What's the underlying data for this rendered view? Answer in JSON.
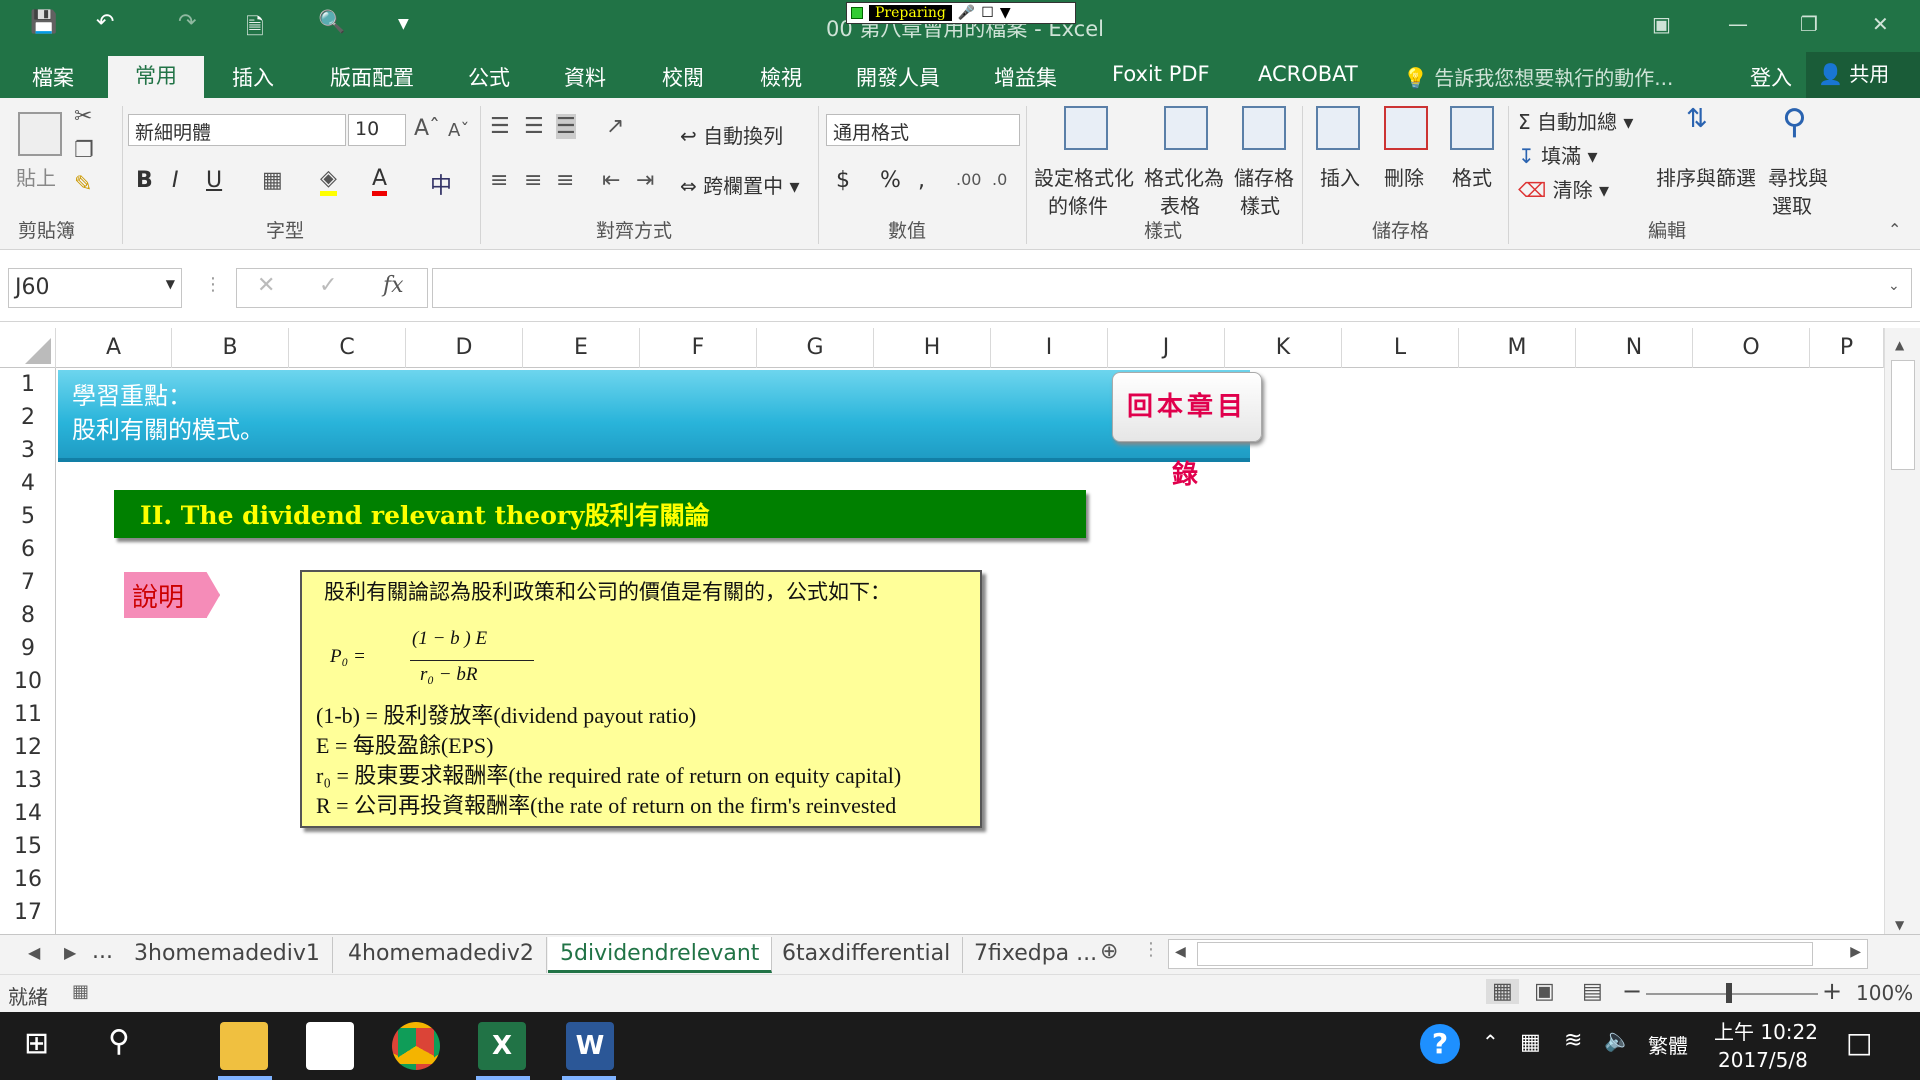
{
  "titlebar": {
    "title": "00 第八章曾用的檔案 - Excel",
    "recorder_status": "Preparing"
  },
  "tabs": [
    "檔案",
    "常用",
    "插入",
    "版面配置",
    "公式",
    "資料",
    "校閱",
    "檢視",
    "開發人員",
    "增益集",
    "Foxit PDF",
    "ACROBAT"
  ],
  "tell_me": "告訴我您想要執行的動作...",
  "sign_in": "登入",
  "share": "共用",
  "ribbon": {
    "paste": "貼上",
    "font_name": "新細明體",
    "font_size": "10",
    "wrap_text": "自動換列",
    "merge_center": "跨欄置中",
    "number_format": "通用格式",
    "cond_format_1": "設定格式化",
    "cond_format_2": "的條件",
    "table_format_1": "格式化為",
    "table_format_2": "表格",
    "cell_styles_1": "儲存格",
    "cell_styles_2": "樣式",
    "insert": "插入",
    "delete": "刪除",
    "format": "格式",
    "autosum": "自動加總",
    "fill": "填滿",
    "clear": "清除",
    "sort_filter": "排序與篩選",
    "find_1": "尋找與",
    "find_2": "選取",
    "groups": {
      "clipboard": "剪貼簿",
      "font": "字型",
      "alignment": "對齊方式",
      "number": "數值",
      "styles": "樣式",
      "cells": "儲存格",
      "editing": "編輯"
    }
  },
  "formula_bar": {
    "name_box": "J60",
    "fx": "fx",
    "content": ""
  },
  "columns": [
    "A",
    "B",
    "C",
    "D",
    "E",
    "F",
    "G",
    "H",
    "I",
    "J",
    "K",
    "L",
    "M",
    "N",
    "O",
    "P"
  ],
  "rows": [
    "1",
    "2",
    "3",
    "4",
    "5",
    "6",
    "7",
    "8",
    "9",
    "10",
    "11",
    "12",
    "13",
    "14",
    "15",
    "16",
    "17"
  ],
  "sheet": {
    "banner_line1": "學習重點：",
    "banner_line2": "股利有關的模式。",
    "back_button": "回本章目錄",
    "heading": "II. The dividend relevant theory股利有關論",
    "note_label": "說明",
    "box": {
      "intro": "股利有關論認為股利政策和公司的價值是有關的，公式如下：",
      "formula_lhs": "P₀  =",
      "formula_num": "(1 − b ) E",
      "formula_den": "r₀ − bR",
      "line1": "(1-b) = 股利發放率(dividend payout ratio)",
      "line2": "E = 每股盈餘(EPS)",
      "line3": "r₀ = 股東要求報酬率(the required rate of return on equity capital)",
      "line4": "R = 公司再投資報酬率(the rate of return on the firm's reinvested"
    }
  },
  "sheet_tabs": [
    "...",
    "3homemadediv1",
    "4homemadediv2",
    "5dividendrelevant",
    "6taxdifferential",
    "7fixedpa ..."
  ],
  "status": {
    "ready": "就緒",
    "zoom": "100%"
  },
  "taskbar": {
    "ime": "繁體",
    "time": "上午 10:22",
    "date": "2017/5/8"
  },
  "colors": {
    "excel_green": "#217346",
    "banner_blue": "#29b4da",
    "heading_green": "#008000",
    "heading_text": "#ffff00",
    "note_pink": "#f58cb8",
    "box_yellow": "#ffff99"
  }
}
